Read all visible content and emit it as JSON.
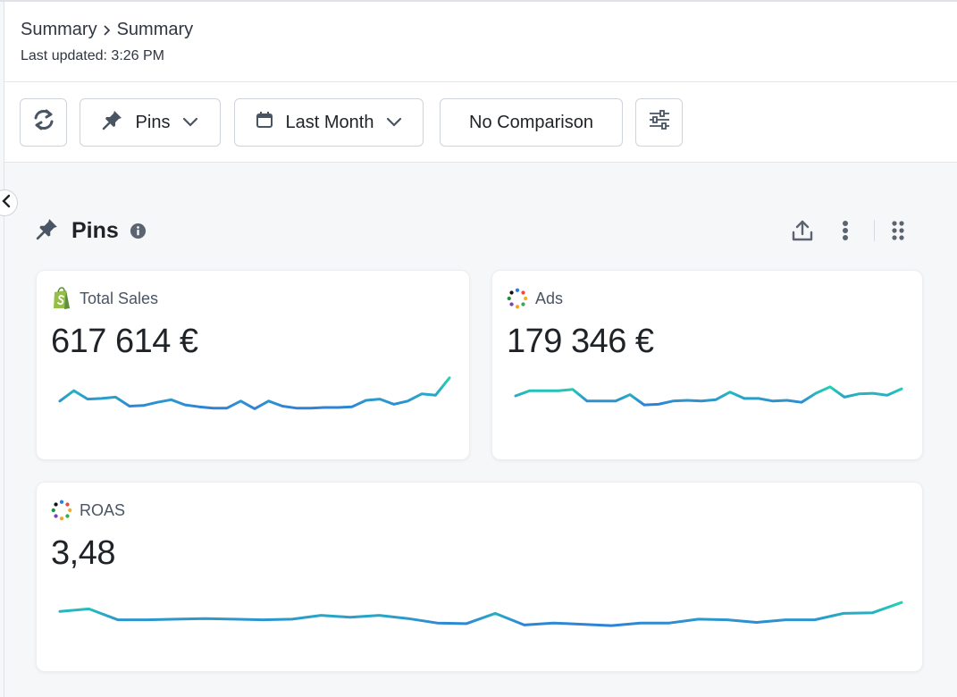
{
  "breadcrumb": {
    "root": "Summary",
    "current": "Summary"
  },
  "last_updated": "Last updated: 3:26 PM",
  "toolbar": {
    "refresh_icon": "refresh-icon",
    "pins_label": "Pins",
    "date_label": "Last Month",
    "comparison_label": "No Comparison",
    "settings_icon": "sliders-icon"
  },
  "section": {
    "title": "Pins",
    "icon": "pin-icon",
    "actions": [
      "upload-icon",
      "more-vertical-icon",
      "drag-grid-icon"
    ]
  },
  "colors": {
    "line_start": "#2f80d8",
    "line_end": "#22d4b0",
    "shopify_green": "#95bf47"
  },
  "cards": [
    {
      "title": "Total Sales",
      "icon": "shopify-icon",
      "value": "617 614 €",
      "sparkline": [
        0.42,
        0.58,
        0.45,
        0.46,
        0.48,
        0.34,
        0.35,
        0.4,
        0.44,
        0.36,
        0.33,
        0.31,
        0.31,
        0.42,
        0.3,
        0.42,
        0.34,
        0.31,
        0.31,
        0.32,
        0.32,
        0.33,
        0.43,
        0.45,
        0.37,
        0.42,
        0.53,
        0.51,
        0.78
      ]
    },
    {
      "title": "Ads",
      "icon": "ads-dots-icon",
      "value": "179 346 €",
      "sparkline": [
        0.5,
        0.58,
        0.58,
        0.58,
        0.6,
        0.42,
        0.42,
        0.42,
        0.52,
        0.36,
        0.37,
        0.42,
        0.43,
        0.42,
        0.44,
        0.56,
        0.46,
        0.46,
        0.42,
        0.43,
        0.4,
        0.54,
        0.64,
        0.48,
        0.53,
        0.54,
        0.51,
        0.61
      ]
    },
    {
      "title": "ROAS",
      "icon": "ads-dots-icon",
      "value": "3,48",
      "sparkline": [
        0.58,
        0.62,
        0.45,
        0.45,
        0.46,
        0.47,
        0.46,
        0.45,
        0.46,
        0.52,
        0.49,
        0.52,
        0.47,
        0.4,
        0.39,
        0.55,
        0.37,
        0.4,
        0.38,
        0.36,
        0.4,
        0.4,
        0.46,
        0.45,
        0.41,
        0.45,
        0.45,
        0.55,
        0.56,
        0.72
      ]
    }
  ]
}
